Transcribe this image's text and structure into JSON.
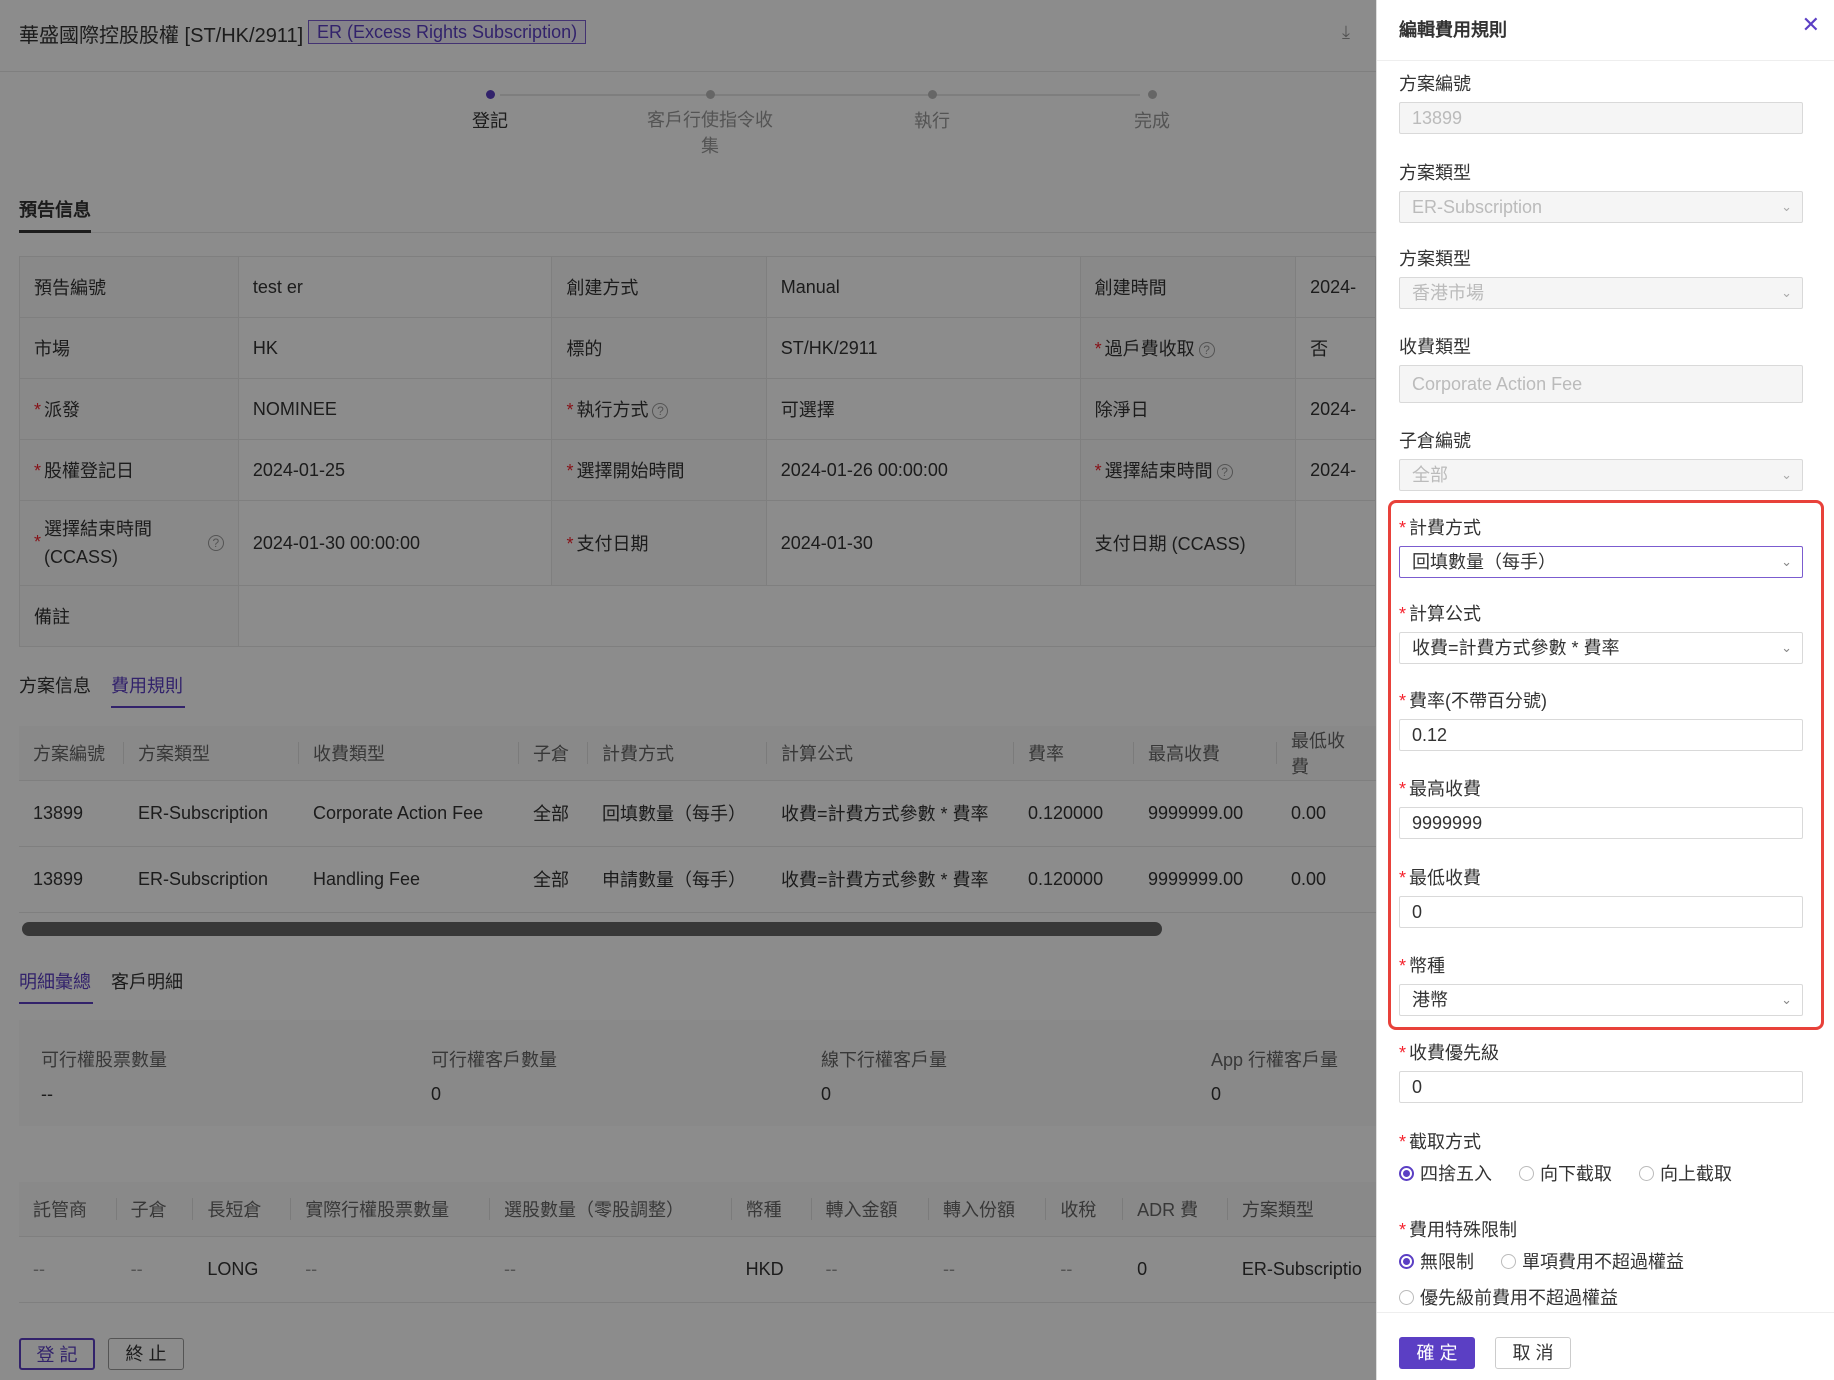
{
  "header": {
    "title": "華盛國際控股股權 [ST/HK/2911]",
    "tag": "ER (Excess Rights Subscription)",
    "download_icon": "download-icon"
  },
  "steps": [
    "登記",
    "客戶行使指令收集",
    "執行",
    "完成"
  ],
  "section": {
    "title": "預告信息"
  },
  "info": {
    "r1": {
      "k1": "預告編號",
      "v1": "test er",
      "k2": "創建方式",
      "v2": "Manual",
      "k3": "創建時間",
      "v3": "2024-"
    },
    "r2": {
      "k1": "市場",
      "v1": "HK",
      "k2": "標的",
      "v2": "ST/HK/2911",
      "k3": "過戶費收取",
      "v3": "否"
    },
    "r3": {
      "k1": "派發",
      "v1": "NOMINEE",
      "k2": "執行方式",
      "v2": "可選擇",
      "k3": "除淨日",
      "v3": "2024-"
    },
    "r4": {
      "k1": "股權登記日",
      "v1": "2024-01-25",
      "k2": "選擇開始時間",
      "v2": "2024-01-26 00:00:00",
      "k3": "選擇結束時間",
      "v3": "2024-"
    },
    "r5": {
      "k1": "選擇結束時間 (CCASS)",
      "v1": "2024-01-30 00:00:00",
      "k2": "支付日期",
      "v2": "2024-01-30",
      "k3": "支付日期 (CCASS)",
      "v3": ""
    },
    "r6": {
      "k1": "備註",
      "v1": ""
    }
  },
  "tabs1": {
    "t1": "方案信息",
    "t2": "費用規則"
  },
  "fee_table": {
    "headers": [
      "方案編號",
      "方案類型",
      "收費類型",
      "子倉",
      "計費方式",
      "計算公式",
      "費率",
      "最高收費",
      "最低收費"
    ],
    "rows": [
      [
        "13899",
        "ER-Subscription",
        "Corporate Action Fee",
        "全部",
        "回填數量（每手）",
        "收費=計費方式參數 * 費率",
        "0.120000",
        "9999999.00",
        "0.00"
      ],
      [
        "13899",
        "ER-Subscription",
        "Handling Fee",
        "全部",
        "申請數量（每手）",
        "收費=計費方式參數 * 費率",
        "0.120000",
        "9999999.00",
        "0.00"
      ]
    ]
  },
  "tabs2": {
    "t1": "明細彙總",
    "t2": "客戶明細"
  },
  "summary": [
    {
      "label": "可行權股票數量",
      "value": "--"
    },
    {
      "label": "可行權客戶數量",
      "value": "0"
    },
    {
      "label": "線下行權客戶量",
      "value": "0"
    },
    {
      "label": "App 行權客戶量",
      "value": "0"
    }
  ],
  "detail_table": {
    "headers": [
      "託管商",
      "子倉",
      "長短倉",
      "實際行權股票數量",
      "選股數量（零股調整）",
      "幣種",
      "轉入金額",
      "轉入份額",
      "收稅",
      "ADR 費",
      "方案類型"
    ],
    "rows": [
      [
        "--",
        "--",
        "LONG",
        "--",
        "--",
        "HKD",
        "--",
        "--",
        "--",
        "0",
        "ER-Subscriptio"
      ]
    ]
  },
  "buttons": {
    "register": "登 記",
    "stop": "終 止"
  },
  "drawer": {
    "title": "編輯費用規則",
    "close_icon": "close-icon",
    "fields": {
      "plan_no": {
        "label": "方案編號",
        "value": "13899"
      },
      "plan_type": {
        "label": "方案類型",
        "value": "ER-Subscription"
      },
      "market": {
        "label": "方案類型",
        "value": "香港市場"
      },
      "fee_type": {
        "label": "收費類型",
        "value": "Corporate Action Fee"
      },
      "sub_account": {
        "label": "子倉編號",
        "value": "全部"
      },
      "billing": {
        "label": "計費方式",
        "value": "回填數量（每手）"
      },
      "formula": {
        "label": "計算公式",
        "value": "收費=計費方式參數 * 費率"
      },
      "rate": {
        "label": "費率(不帶百分號)",
        "value": "0.12"
      },
      "max_fee": {
        "label": "最高收費",
        "value": "9999999"
      },
      "min_fee": {
        "label": "最低收費",
        "value": "0"
      },
      "currency": {
        "label": "幣種",
        "value": "港幣"
      },
      "priority": {
        "label": "收費優先級",
        "value": "0"
      }
    },
    "rounding": {
      "label": "截取方式",
      "options": [
        "四捨五入",
        "向下截取",
        "向上截取"
      ],
      "selected": "四捨五入"
    },
    "limit": {
      "label": "費用特殊限制",
      "options": [
        "無限制",
        "單項費用不超過權益",
        "優先級前費用不超過權益"
      ],
      "selected": "無限制"
    },
    "ok": "確 定",
    "cancel": "取 消"
  },
  "colors": {
    "accent": "#5b3fc4",
    "highlight": "#e8413a"
  }
}
